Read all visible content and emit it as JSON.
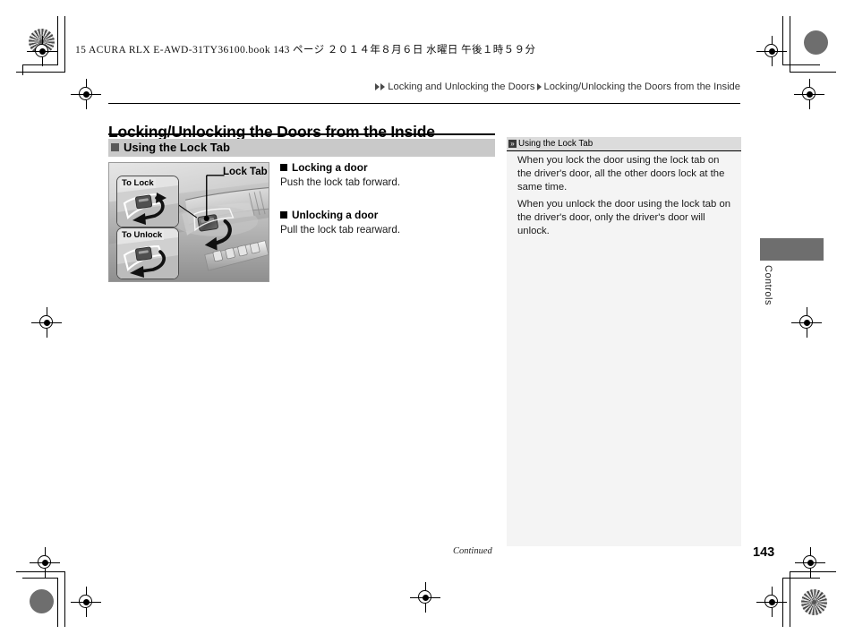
{
  "print_header": {
    "book_line": "15 ACURA RLX E-AWD-31TY36100.book   143 ページ   ２０１４年８月６日   水曜日   午後１時５９分"
  },
  "breadcrumb": {
    "level1": "Locking and Unlocking the Doors",
    "level2": "Locking/Unlocking the Doors from the Inside",
    "marker_icon": "triangle-right-icon"
  },
  "page": {
    "title": "Locking/Unlocking the Doors from the Inside",
    "subheading": "Using the Lock Tab",
    "subheading_bullet_icon": "square-bullet-icon"
  },
  "figure": {
    "callout_label": "Lock Tab",
    "inset_lock_label": "To Lock",
    "inset_unlock_label": "To Unlock",
    "alt": "Driver door panel showing the lock tab with To Lock and To Unlock insets"
  },
  "main": {
    "blocks": [
      {
        "heading": "Locking a door",
        "text": "Push the lock tab forward.",
        "bullet_icon": "square-bullet-icon"
      },
      {
        "heading": "Unlocking a door",
        "text": "Pull the lock tab rearward.",
        "bullet_icon": "square-bullet-icon"
      }
    ]
  },
  "sidebar": {
    "header_icon": "double-chevron-right-icon",
    "header_title": "Using the Lock Tab",
    "paragraphs": [
      "When you lock the door using the lock tab on the driver's door, all the other doors lock at the same time.",
      "When you unlock the door using the lock tab on the driver's door, only the driver's door will unlock."
    ]
  },
  "edge_tab": {
    "section_label": "Controls"
  },
  "footer": {
    "continued": "Continued",
    "page_number": "143"
  },
  "colors": {
    "subhead_bar": "#c9c9c9",
    "sidebar_bg": "#f4f4f4",
    "sidebar_header_bg": "#dcdcdc",
    "edge_tab": "#6e6e6e",
    "bullet": "#595959"
  }
}
